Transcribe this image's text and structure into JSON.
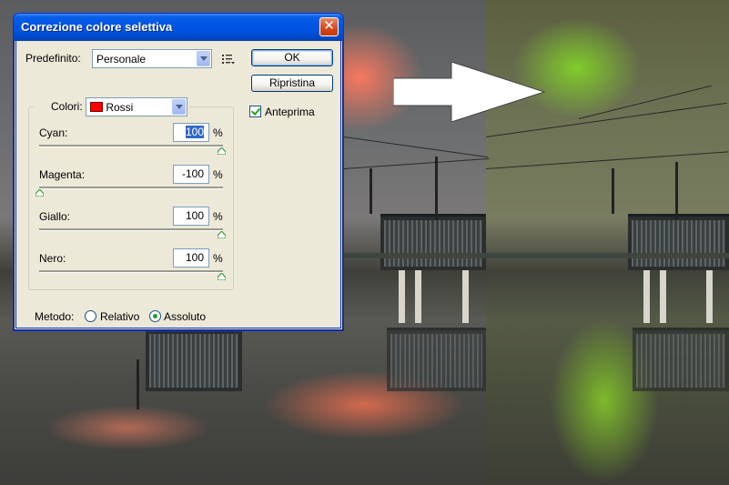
{
  "dialog": {
    "title": "Correzione colore selettiva",
    "preset": {
      "label": "Predefinito:",
      "value": "Personale"
    },
    "buttons": {
      "ok": "OK",
      "reset": "Ripristina"
    },
    "preview": {
      "label": "Anteprima",
      "checked": true
    },
    "colors": {
      "label": "Colori:",
      "value": "Rossi",
      "swatch": "#ff0000"
    },
    "sliders": [
      {
        "label": "Cyan:",
        "value": "100",
        "unit": "%",
        "selected": true,
        "level": 1.0
      },
      {
        "label": "Magenta:",
        "value": "-100",
        "unit": "%",
        "selected": false,
        "level": 0.0
      },
      {
        "label": "Giallo:",
        "value": "100",
        "unit": "%",
        "selected": false,
        "level": 1.0
      },
      {
        "label": "Nero:",
        "value": "100",
        "unit": "%",
        "selected": false,
        "level": 1.0
      }
    ],
    "method": {
      "label": "Metodo:",
      "options": [
        {
          "label": "Relativo",
          "checked": false
        },
        {
          "label": "Assoluto",
          "checked": true
        }
      ]
    }
  },
  "icons": {
    "close": "close-icon",
    "menu": "panel-menu-icon",
    "arrow": "right-arrow-icon"
  },
  "colors": {
    "titlebar": "#0054e3",
    "dialog_bg": "#ece9d8",
    "check": "#21a121"
  }
}
